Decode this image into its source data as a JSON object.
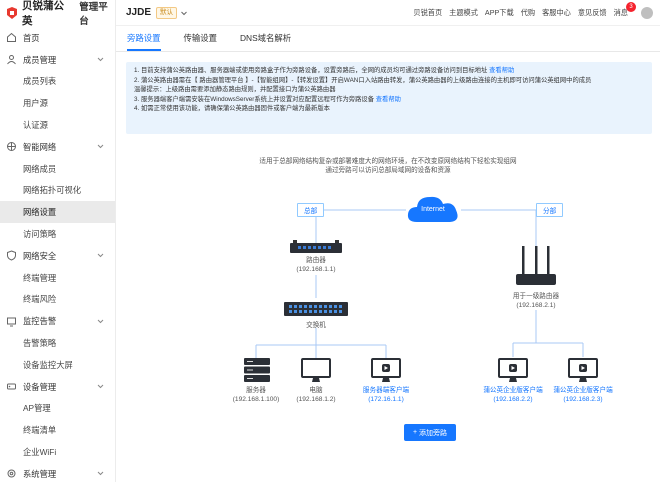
{
  "brand": {
    "name": "贝锐蒲公英",
    "subtitle": "管理平台"
  },
  "sidebar": {
    "home": "首页",
    "groups": [
      {
        "label": "成员管理",
        "items": [
          "成员列表",
          "用户源",
          "认证源"
        ]
      },
      {
        "label": "智能网络",
        "items": [
          "网络成员",
          "网络拓扑可视化",
          "网络设置",
          "访问策略"
        ]
      },
      {
        "label": "网络安全",
        "items": [
          "终端管理",
          "终端风险"
        ]
      },
      {
        "label": "监控告警",
        "items": [
          "告警策略",
          "设备监控大屏"
        ]
      },
      {
        "label": "设备管理",
        "items": [
          "AP管理",
          "终端清单",
          "企业WiFi"
        ]
      },
      {
        "label": "系统管理",
        "items": []
      }
    ]
  },
  "header": {
    "project": "JJDE",
    "badge": "默认",
    "links": [
      "贝锐首页",
      "主题模式",
      "APP下载",
      "代购",
      "客服中心",
      "意见反馈",
      "消息"
    ],
    "message_count": "3"
  },
  "tabs": [
    "旁路设置",
    "传输设置",
    "DNS域名解析"
  ],
  "info": {
    "lines": [
      {
        "text": "1. 目前支持蒲公英路由器、服务器端或使用旁路盒子作为旁路设备，设置旁路后，全网的成员均可通过旁路设备访问到目标地址 ",
        "link": "查看帮助"
      },
      {
        "text": "2. 蒲公英路由器需在【 路由器管理平台 】-【智能组网】-【转发设置】开启WAN口入站路由转发，蒲公英路由器的上级路由连接的主机即可访问蒲公英组网中的成员",
        "link": ""
      },
      {
        "text": "    温馨提示：上级路由需要添加静态路由规则，并配置接口为蒲公英路由器",
        "link": ""
      },
      {
        "text": "3. 服务器端客户端需安装在WindowsServer系统上并设置对应配置远程可作为旁路设备 ",
        "link": "查看帮助"
      },
      {
        "text": "4. 如需正常使用该功能，请确保蒲公英路由器固件或客户端为最新版本",
        "link": ""
      }
    ]
  },
  "topology": {
    "description": [
      "适用于总部网络结构复杂或部署难度大的网络环境，在不改变原网络结构下轻松实现组网",
      "通过旁路可以访问总部局域网的设备和资源"
    ],
    "hq_label": "总部",
    "branch_label": "分部",
    "cloud": "Internet",
    "router": {
      "name": "路由器",
      "ip": "(192.168.1.1)"
    },
    "switch": {
      "name": "交换机"
    },
    "server": {
      "name": "服务器",
      "ip": "(192.168.1.100)"
    },
    "pc": {
      "name": "电脑",
      "ip": "(192.168.1.2)"
    },
    "bypass_client": {
      "name": "服务器端客户端",
      "ip": "(172.16.1.1)"
    },
    "branch_router": {
      "name": "用于一级路由器",
      "ip": "(192.168.2.1)"
    },
    "client1": {
      "name": "蒲公英企业版客户端",
      "ip": "(192.168.2.2)"
    },
    "client2": {
      "name": "蒲公英企业版客户端",
      "ip": "(192.168.2.3)"
    },
    "add_button": "添加旁路"
  },
  "colors": {
    "accent": "#1677ff",
    "brand": "#e8392f",
    "info_bg": "#e9f3fd",
    "line": "#a9c8f5"
  },
  "icons": [
    "home-icon",
    "users-icon",
    "network-icon",
    "shield-icon",
    "monitor-alert-icon",
    "device-icon",
    "settings-icon",
    "chevron-down-icon",
    "cloud-icon",
    "router-icon",
    "switch-icon",
    "server-icon",
    "pc-icon",
    "plus-icon"
  ]
}
